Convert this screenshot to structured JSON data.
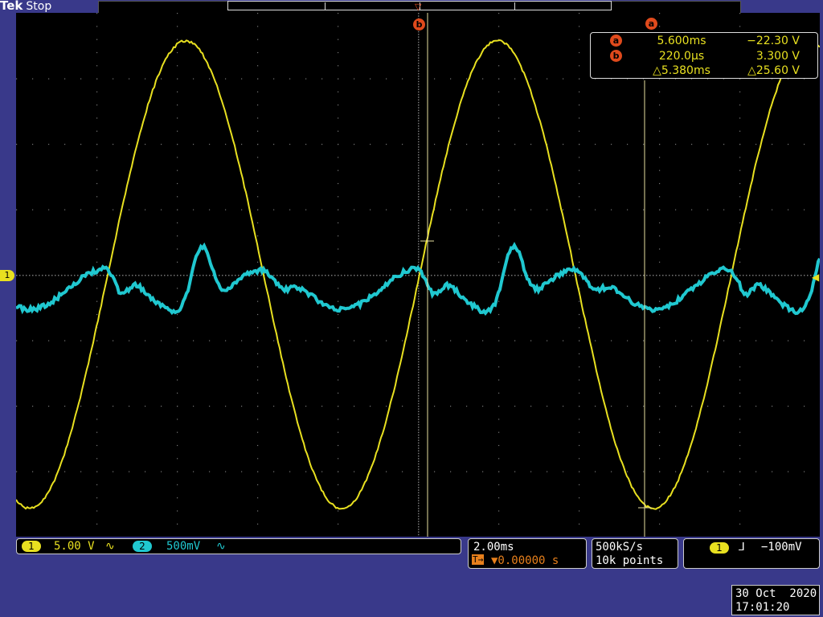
{
  "header": {
    "brand": "Tek",
    "acquisition_state": "Stop"
  },
  "colors": {
    "ch1": "#e8e020",
    "ch2": "#20c8d0",
    "cursor": "#e04a1c",
    "background": "#39398a"
  },
  "cursors": {
    "marker_a": "a",
    "marker_b": "b",
    "a": {
      "label": "a",
      "time": "5.600ms",
      "voltage": "−22.30 V"
    },
    "b": {
      "label": "b",
      "time": "220.0µs",
      "voltage": "3.300 V"
    },
    "delta": {
      "time": "△5.380ms",
      "voltage": "△25.60 V"
    }
  },
  "channels": {
    "ch1": {
      "number": "1",
      "scale": "5.00 V",
      "coupling_icon": "∿"
    },
    "ch2": {
      "number": "2",
      "scale": "500mV",
      "coupling_icon": "∿"
    }
  },
  "ground_marker": "1",
  "timebase": {
    "scale": "2.00ms",
    "trigger_position": "▼0.00000 s",
    "trigger_icon": "T→"
  },
  "acquisition": {
    "sample_rate": "500kS/s",
    "record_length": "10k points"
  },
  "trigger": {
    "source": "1",
    "slope_icon": "⅃",
    "level": "−100mV"
  },
  "datetime": {
    "date": "30 Oct  2020",
    "time": "17:01:20"
  }
}
